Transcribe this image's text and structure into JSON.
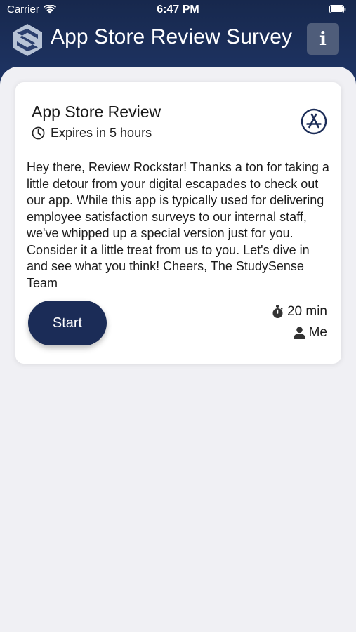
{
  "status_bar": {
    "carrier": "Carrier",
    "time": "6:47 PM"
  },
  "nav": {
    "title": "App Store Review Survey",
    "info_label": "i"
  },
  "survey": {
    "title": "App Store Review",
    "expires": "Expires in 5 hours",
    "description": "Hey there, Review Rockstar! Thanks a ton for taking a little detour from your digital escapades to check out our app. While this app is typically used for delivering employee satisfaction surveys to our internal staff, we've whipped up a special version just for you. Consider it a little treat from us to you. Let's dive in and see what you think! Cheers, The StudySense Team",
    "start_label": "Start",
    "duration": "20 min",
    "assignee": "Me"
  },
  "icons": {
    "logo": "studysense-logo-icon",
    "info": "info-icon",
    "clock": "clock-icon",
    "store": "app-store-icon",
    "stopwatch": "stopwatch-icon",
    "person": "person-icon"
  },
  "colors": {
    "header": "#1f3566",
    "accent": "#1b2c57",
    "info_button": "#4f5d7a",
    "background": "#f0f0f4"
  }
}
